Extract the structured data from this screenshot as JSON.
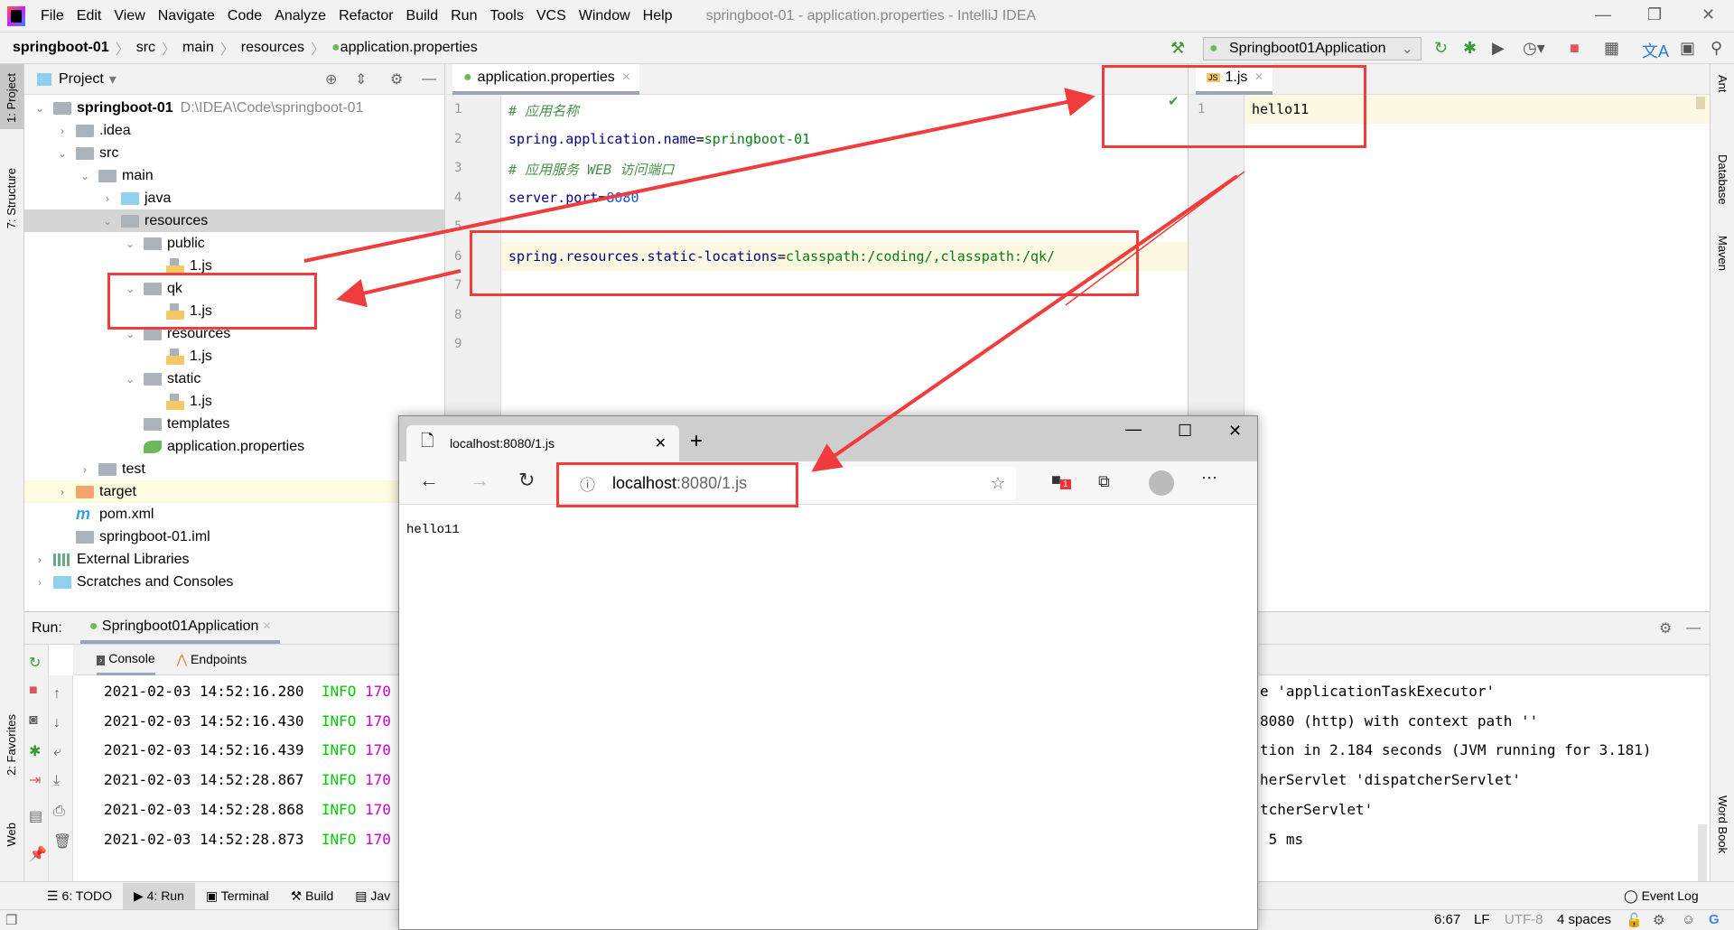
{
  "menu": {
    "items": [
      "File",
      "Edit",
      "View",
      "Navigate",
      "Code",
      "Analyze",
      "Refactor",
      "Build",
      "Run",
      "Tools",
      "VCS",
      "Window",
      "Help"
    ],
    "title": "springboot-01 - application.properties - IntelliJ IDEA"
  },
  "breadcrumb": [
    "springboot-01",
    "src",
    "main",
    "resources",
    "application.properties"
  ],
  "run_config": "Springboot01Application",
  "left_strip": [
    "1: Project",
    "7: Structure",
    "2: Favorites",
    "Web"
  ],
  "right_strip": [
    "Ant",
    "Database",
    "Maven",
    "Word Book"
  ],
  "project": {
    "title": "Project",
    "tree": [
      {
        "label": "springboot-01",
        "path": "D:\\IDEA\\Code\\springboot-01",
        "level": 0,
        "arrow": "down",
        "icon": "module",
        "bold": true
      },
      {
        "label": ".idea",
        "level": 1,
        "arrow": "right",
        "icon": "folder"
      },
      {
        "label": "src",
        "level": 1,
        "arrow": "down",
        "icon": "folder"
      },
      {
        "label": "main",
        "level": 2,
        "arrow": "down",
        "icon": "folder"
      },
      {
        "label": "java",
        "level": 3,
        "arrow": "right",
        "icon": "source-folder"
      },
      {
        "label": "resources",
        "level": 3,
        "arrow": "down",
        "icon": "resources-folder",
        "selected": true
      },
      {
        "label": "public",
        "level": 4,
        "arrow": "down",
        "icon": "folder"
      },
      {
        "label": "1.js",
        "level": 5,
        "icon": "js-file"
      },
      {
        "label": "qk",
        "level": 4,
        "arrow": "down",
        "icon": "folder"
      },
      {
        "label": "1.js",
        "level": 5,
        "icon": "js-file"
      },
      {
        "label": "resources",
        "level": 4,
        "arrow": "down",
        "icon": "folder"
      },
      {
        "label": "1.js",
        "level": 5,
        "icon": "js-file"
      },
      {
        "label": "static",
        "level": 4,
        "arrow": "down",
        "icon": "folder"
      },
      {
        "label": "1.js",
        "level": 5,
        "icon": "js-file"
      },
      {
        "label": "templates",
        "level": 4,
        "icon": "folder"
      },
      {
        "label": "application.properties",
        "level": 4,
        "icon": "spring-file"
      },
      {
        "label": "test",
        "level": 2,
        "arrow": "right",
        "icon": "folder"
      },
      {
        "label": "target",
        "level": 1,
        "arrow": "right",
        "icon": "excluded-folder",
        "excluded": true
      },
      {
        "label": "pom.xml",
        "level": 1,
        "icon": "maven-file"
      },
      {
        "label": "springboot-01.iml",
        "level": 1,
        "icon": "iml-file"
      },
      {
        "label": "External Libraries",
        "level": 0,
        "arrow": "right",
        "icon": "library"
      },
      {
        "label": "Scratches and Consoles",
        "level": 0,
        "arrow": "right",
        "icon": "scratches"
      }
    ]
  },
  "editor": {
    "tab": "application.properties",
    "lines": [
      [
        {
          "t": "# 应用名称",
          "c": "c"
        }
      ],
      [
        {
          "t": "spring.application.name",
          "c": "k"
        },
        {
          "t": "=",
          "c": ""
        },
        {
          "t": "springboot-01",
          "c": "v"
        }
      ],
      [
        {
          "t": "# 应用服务 WEB 访问端口",
          "c": "c"
        }
      ],
      [
        {
          "t": "server.port",
          "c": "k"
        },
        {
          "t": "=",
          "c": ""
        },
        {
          "t": "8080",
          "c": "n"
        }
      ],
      [],
      [
        {
          "t": "spring.resources.static-locations",
          "c": "k"
        },
        {
          "t": "=",
          "c": ""
        },
        {
          "t": "classpath:/coding/,classpath:/qk/",
          "c": "v"
        }
      ],
      [],
      [],
      []
    ],
    "current_line": 6
  },
  "editor2": {
    "tab": "1.js",
    "lines": [
      "hello11"
    ]
  },
  "run": {
    "label": "Run:",
    "tab": "Springboot01Application",
    "subtabs": [
      "Console",
      "Endpoints"
    ],
    "lines": [
      {
        "time": "2021-02-03 14:52:16.280",
        "level": "INFO",
        "pid": "170",
        "tail": "e 'applicationTaskExecutor'"
      },
      {
        "time": "2021-02-03 14:52:16.430",
        "level": "INFO",
        "pid": "170",
        "tail": "8080 (http) with context path ''"
      },
      {
        "time": "2021-02-03 14:52:16.439",
        "level": "INFO",
        "pid": "170",
        "tail": "tion in 2.184 seconds (JVM running for 3.181)"
      },
      {
        "time": "2021-02-03 14:52:28.867",
        "level": "INFO",
        "pid": "170",
        "tail": "herServlet 'dispatcherServlet'"
      },
      {
        "time": "2021-02-03 14:52:28.868",
        "level": "INFO",
        "pid": "170",
        "tail": "tcherServlet'"
      },
      {
        "time": "2021-02-03 14:52:28.873",
        "level": "INFO",
        "pid": "170",
        "tail": " 5 ms"
      }
    ]
  },
  "bottom_tabs": [
    "6: TODO",
    "4: Run",
    "Terminal",
    "Build",
    "Jav"
  ],
  "event_log": "Event Log",
  "status": {
    "position": "6:67",
    "line_sep": "LF",
    "encoding": "UTF-8",
    "indent": "4 spaces"
  },
  "browser": {
    "tab_title": "localhost:8080/1.js",
    "address_host": "localhost",
    "address_rest": ":8080/1.js",
    "content": "hello11",
    "ext_badge": "1"
  },
  "colors": {
    "annotation": "#f03c3c",
    "info": "#00cc00",
    "pid": "#cc00cc",
    "keyword": "#000080",
    "value": "#067d17"
  }
}
